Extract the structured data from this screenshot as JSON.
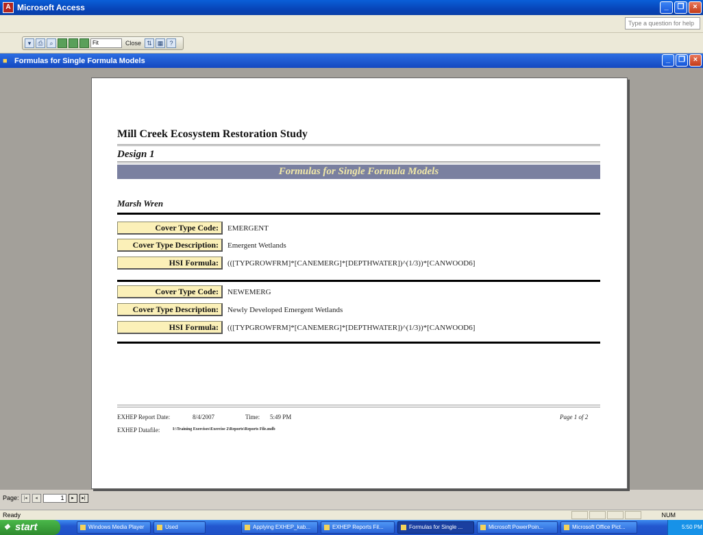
{
  "app": {
    "title": "Microsoft Access",
    "help_placeholder": "Type a question for help"
  },
  "toolbar": {
    "zoom_value": "Fit",
    "close_label": "Close"
  },
  "doc_window": {
    "title": "Formulas for Single Formula Models"
  },
  "report": {
    "title": "Mill Creek Ecosystem Restoration Study",
    "design": "Design 1",
    "band": "Formulas for Single Formula Models",
    "species": "Marsh Wren",
    "records": [
      {
        "cover_type_code_label": "Cover Type Code:",
        "cover_type_code": "EMERGENT",
        "cover_type_desc_label": "Cover Type Description:",
        "cover_type_desc": "Emergent Wetlands",
        "hsi_label": "HSI Formula:",
        "hsi_formula": "(([TYPGROWFRM]*[CANEMERG]*[DEPTHWATER])^(1/3))*[CANWOOD6]"
      },
      {
        "cover_type_code_label": "Cover Type Code:",
        "cover_type_code": "NEWEMERG",
        "cover_type_desc_label": "Cover Type Description:",
        "cover_type_desc": "Newly Developed Emergent Wetlands",
        "hsi_label": "HSI Formula:",
        "hsi_formula": "(([TYPGROWFRM]*[CANEMERG]*[DEPTHWATER])^(1/3))*[CANWOOD6]"
      }
    ],
    "footer": {
      "report_date_label": "EXHEP Report Date:",
      "report_date": "8/4/2007",
      "time_label": "Time:",
      "time": "5:49 PM",
      "page_text": "Page 1 of 2",
      "datafile_label": "EXHEP Datafile:",
      "datafile": "I:\\Training Exercises\\Exercise 2\\Reports\\Reports File.mdb"
    }
  },
  "page_nav": {
    "label": "Page:",
    "current": "1"
  },
  "status": {
    "text": "Ready",
    "num": "NUM"
  },
  "taskbar": {
    "start": "start",
    "tasks": [
      "Windows Media Player",
      "Used",
      "Applying EXHEP_kab...",
      "EXHEP Reports Fil...",
      "Formulas for Single ...",
      "Microsoft PowerPoin...",
      "Microsoft Office Pict..."
    ],
    "clock": "5:50 PM"
  }
}
